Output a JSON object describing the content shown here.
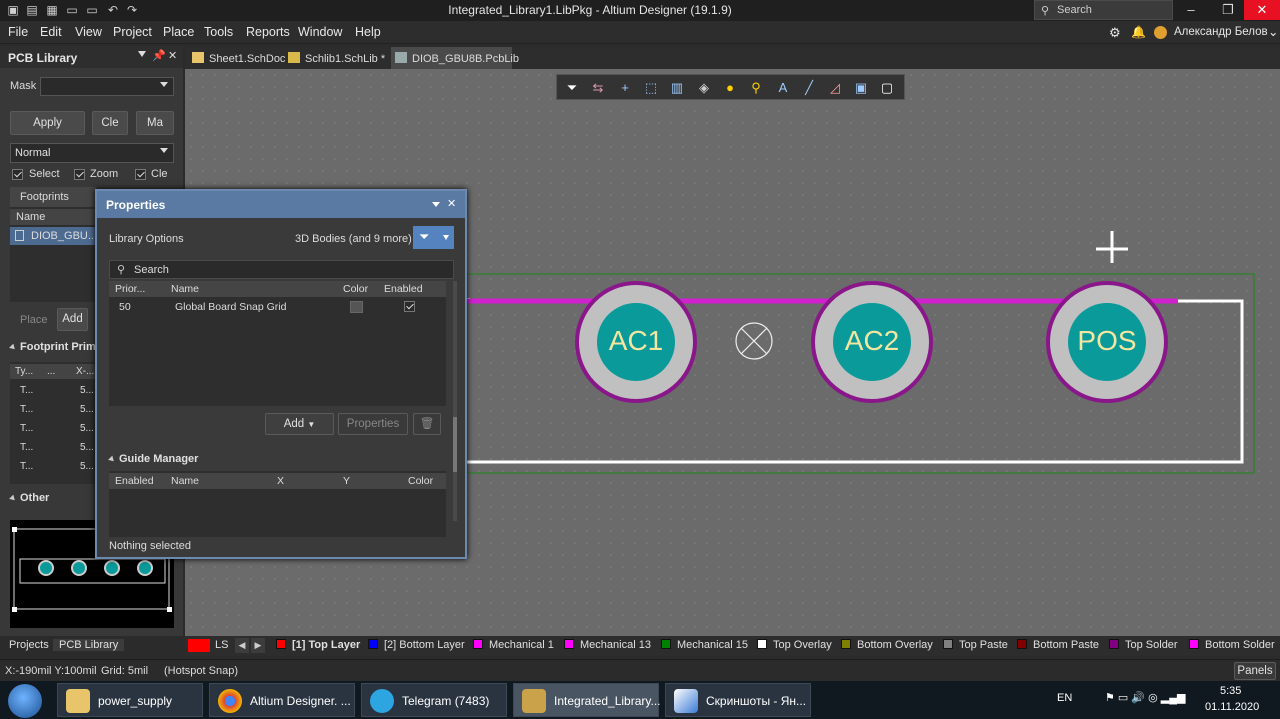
{
  "app": {
    "title": "Integrated_Library1.LibPkg - Altium Designer (19.1.9)",
    "search_placeholder": "Search",
    "user_name": "Александр Белов"
  },
  "menu": [
    "File",
    "Edit",
    "View",
    "Project",
    "Place",
    "Tools",
    "Reports",
    "Window",
    "Help"
  ],
  "left_panel": {
    "title": "PCB Library",
    "mask_label": "Mask",
    "apply_label": "Apply",
    "clear_label": "Cle",
    "magnify_label": "Ma",
    "mode_value": "Normal",
    "select_label": "Select",
    "zoom_label": "Zoom",
    "clear2_label": "Cle",
    "footprints_header": "Footprints",
    "name_col": "Name",
    "footprint_item": "DIOB_GBU...",
    "place_label": "Place",
    "add_label": "Add",
    "primitives_header": "Footprint Primi",
    "prim_cols": [
      "Ty...",
      "...",
      "X-..."
    ],
    "prim_rows": [
      [
        "T...",
        "5..."
      ],
      [
        "T...",
        "5..."
      ],
      [
        "T...",
        "5..."
      ],
      [
        "T...",
        "5..."
      ],
      [
        "T...",
        "5..."
      ]
    ],
    "other_header": "Other"
  },
  "panel_tabs": [
    "Projects",
    "PCB Library"
  ],
  "doc_tabs": [
    {
      "label": "Sheet1.SchDoc"
    },
    {
      "label": "Schlib1.SchLib *"
    },
    {
      "label": "DIOB_GBU8B.PcbLib"
    }
  ],
  "pads": [
    "AC1",
    "AC2",
    "POS"
  ],
  "properties": {
    "title": "Properties",
    "library_options": "Library Options",
    "filter_text": "3D Bodies (and 9 more)",
    "search_placeholder": "Search",
    "cols": [
      "Prior...",
      "Name",
      "Color",
      "Enabled"
    ],
    "rows": [
      {
        "priority": "50",
        "name": "Global Board Snap Grid",
        "enabled": true
      }
    ],
    "add_label": "Add",
    "properties_label": "Properties",
    "guide_manager": "Guide Manager",
    "guide_cols": [
      "Enabled",
      "Name",
      "X",
      "Y",
      "Color"
    ],
    "status": "Nothing selected"
  },
  "layers": [
    {
      "label": "LS",
      "color": "#ff0000"
    },
    {
      "label": "[1] Top Layer",
      "color": "#ff0000"
    },
    {
      "label": "[2] Bottom Layer",
      "color": "#0000ff"
    },
    {
      "label": "Mechanical 1",
      "color": "#ff00ff"
    },
    {
      "label": "Mechanical 13",
      "color": "#ff00ff"
    },
    {
      "label": "Mechanical 15",
      "color": "#008000"
    },
    {
      "label": "Top Overlay",
      "color": "#ffffff"
    },
    {
      "label": "Bottom Overlay",
      "color": "#808000"
    },
    {
      "label": "Top Paste",
      "color": "#808080"
    },
    {
      "label": "Bottom Paste",
      "color": "#800000"
    },
    {
      "label": "Top Solder",
      "color": "#800080"
    },
    {
      "label": "Bottom Solder",
      "color": "#ff00ff"
    }
  ],
  "status": {
    "coords": "X:-190mil Y:100mil",
    "grid": "Grid: 5mil",
    "snap": "(Hotspot Snap)",
    "panels": "Panels"
  },
  "taskbar": {
    "items": [
      "power_supply",
      "Altium Designer. ...",
      "Telegram (7483)",
      "Integrated_Library...",
      "Скриншоты - Ян..."
    ],
    "lang": "EN",
    "time": "5:35",
    "date": "01.11.2020"
  }
}
